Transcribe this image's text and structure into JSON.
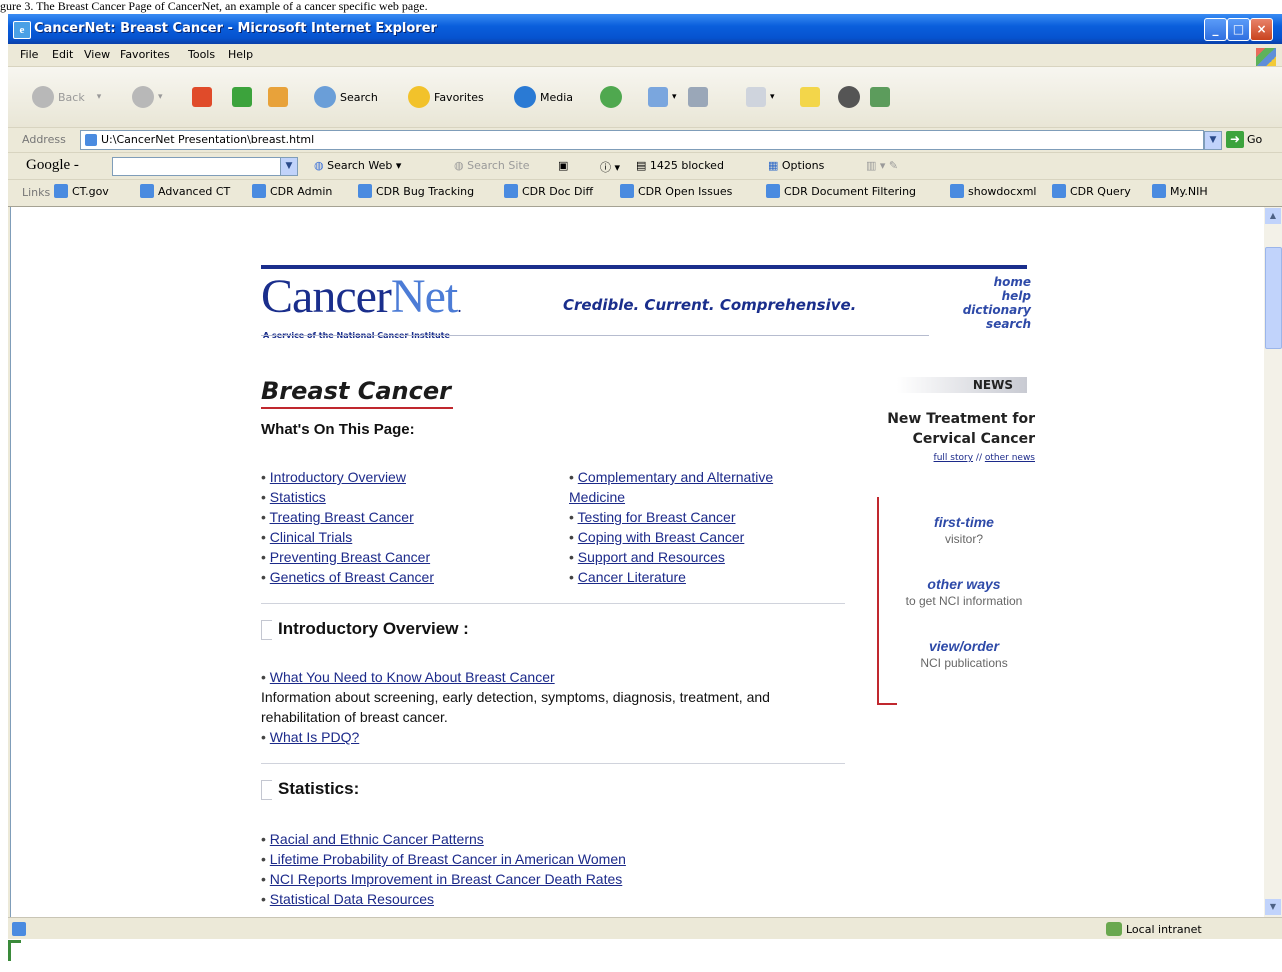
{
  "caption": "gure 3. The Breast Cancer Page of CancerNet, an example of a cancer specific web page.",
  "window": {
    "title": "CancerNet: Breast Cancer - Microsoft Internet Explorer"
  },
  "menu": [
    "File",
    "Edit",
    "View",
    "Favorites",
    "Tools",
    "Help"
  ],
  "toolbar": {
    "back": "Back",
    "search": "Search",
    "favorites": "Favorites",
    "media": "Media"
  },
  "address": {
    "label": "Address",
    "value": "U:\\CancerNet Presentation\\breast.html",
    "go": "Go"
  },
  "googlebar": {
    "logo": "Google -",
    "search_web": "Search Web",
    "search_site": "Search Site",
    "blocked": "1425 blocked",
    "options": "Options"
  },
  "links": {
    "label": "Links",
    "items": [
      "CT.gov",
      "Advanced CT",
      "CDR Admin",
      "CDR Bug Tracking",
      "CDR Doc Diff",
      "CDR Open Issues",
      "CDR Document Filtering",
      "showdocxml",
      "CDR Query",
      "My.NIH"
    ]
  },
  "page": {
    "logo_cancer": "Cancer",
    "logo_net": "Net",
    "logo_tm": ".",
    "logo_sub": "A service of the National Cancer Institute",
    "tagline": "Credible. Current. Comprehensive.",
    "top_links": [
      "home",
      "help",
      "dictionary",
      "search"
    ],
    "title": "Breast Cancer",
    "subtitle": "What's On This Page:",
    "toc_left": [
      "Introductory Overview",
      "Statistics",
      "Treating Breast Cancer",
      "Clinical Trials",
      "Preventing Breast Cancer",
      "Genetics of Breast Cancer"
    ],
    "toc_right_first": "Complementary and Alternative",
    "toc_right_first_cont": "Medicine",
    "toc_right": [
      "Testing for Breast Cancer",
      "Coping with Breast Cancer",
      "Support and Resources",
      "Cancer Literature"
    ],
    "intro_heading": "Introductory Overview :",
    "intro_link1": "What You Need to Know About Breast Cancer",
    "intro_text1": "Information about screening, early detection, symptoms, diagnosis, treatment, and",
    "intro_text2": "rehabilitation of breast cancer.",
    "intro_link2": "What Is PDQ?",
    "stats_heading": "Statistics:",
    "stats_links": [
      "Racial and Ethnic Cancer Patterns",
      "Lifetime Probability of Breast Cancer in American Women",
      "NCI Reports Improvement in Breast Cancer Death Rates",
      "Statistical Data Resources"
    ],
    "news_label": "NEWS",
    "news_title_1": "New Treatment for",
    "news_title_2": "Cervical Cancer",
    "news_full": "full story",
    "news_sep": "//",
    "news_other": "other news",
    "side_first_title": "first-time",
    "side_first_sub": "visitor?",
    "side_other_title": "other ways",
    "side_other_sub": "to get NCI information",
    "side_view_title": "view/order",
    "side_view_sub": "NCI publications"
  },
  "status": {
    "zone": "Local intranet"
  }
}
